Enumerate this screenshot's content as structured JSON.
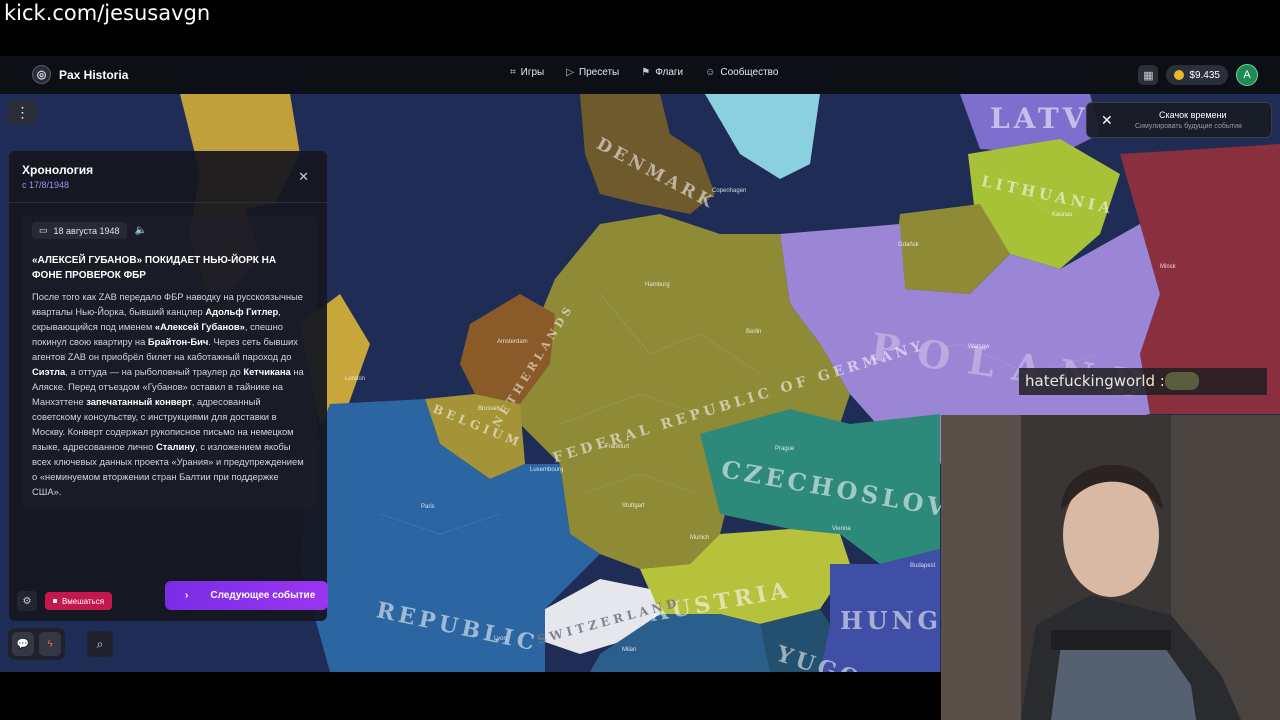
{
  "watermark": {
    "text": "kick.com/jesusavgn"
  },
  "app": {
    "title": "Pax Historia",
    "logo_icon": "globe-icon"
  },
  "nav": {
    "items": [
      {
        "label": "Игры",
        "icon": "gamepad-icon"
      },
      {
        "label": "Пресеты",
        "icon": "play-icon"
      },
      {
        "label": "Флаги",
        "icon": "flag-icon"
      },
      {
        "label": "Сообщество",
        "icon": "users-icon"
      }
    ],
    "balance": "$9.435",
    "avatar_letter": "A"
  },
  "map": {
    "countries": [
      {
        "label": "DENMARK",
        "color": "#6e5a2c"
      },
      {
        "label": "LITHUANIA",
        "color": "#a8c238"
      },
      {
        "label": "LATV",
        "color": "#7e6fcf"
      },
      {
        "label": "POLAND",
        "color": "#9b86d6"
      },
      {
        "label": "FEDERAL REPUBLIC OF GERMANY",
        "color": "#8f8a36"
      },
      {
        "label": "NETHERLANDS",
        "color": "#8a5a28"
      },
      {
        "label": "BELGIUM",
        "color": "#a49437"
      },
      {
        "label": "CZECHOSLOV",
        "color": "#2d8a7b"
      },
      {
        "label": "AUSTRIA",
        "color": "#b6c13c"
      },
      {
        "label": "SWITZERLAND",
        "color": "#e5e7ec"
      },
      {
        "label": "HUNG",
        "color": "#3f4fa6"
      },
      {
        "label": "REPUBLIC",
        "color": "#2c66a2"
      },
      {
        "label": "YUGO",
        "color": "#23506e"
      }
    ],
    "cities": [
      "Copenhagen",
      "Kaunas",
      "Gdańsk",
      "Minsk",
      "Hamburg",
      "Berlin",
      "Warsaw",
      "Amsterdam",
      "Brussels",
      "London",
      "Frankfurt",
      "Prague",
      "Luxembourg",
      "Paris",
      "Stuttgart",
      "Munich",
      "Vienna",
      "Budapest",
      "Milan",
      "Lyon"
    ]
  },
  "timeline": {
    "title": "Хронология",
    "subtitle": "с 17/8/1948",
    "event": {
      "date": "18 августа 1948",
      "headline": "«АЛЕКСЕЙ ГУБАНОВ» ПОКИДАЕТ НЬЮ-ЙОРК НА ФОНЕ ПРОВЕРОК ФБР",
      "body": [
        {
          "text": "После того как ZAB передало ФБР наводку на русскоязычные кварталы Нью-Йорка, бывший канцлер ",
          "bold": false
        },
        {
          "text": "Адольф Гитлер",
          "bold": true
        },
        {
          "text": ", скрывающийся под именем ",
          "bold": false
        },
        {
          "text": "«Алексей Губанов»",
          "bold": true
        },
        {
          "text": ", спешно покинул свою квартиру на ",
          "bold": false
        },
        {
          "text": "Брайтон-Бич",
          "bold": true
        },
        {
          "text": ". Через сеть бывших агентов ZAB он приобрёл билет на каботажный пароход до ",
          "bold": false
        },
        {
          "text": "Сиэтла",
          "bold": true
        },
        {
          "text": ", а оттуда — на рыболовный траулер до ",
          "bold": false
        },
        {
          "text": "Кетчикана",
          "bold": true
        },
        {
          "text": " на Аляске. Перед отъездом «Губанов» оставил в тайнике на Манхэттене ",
          "bold": false
        },
        {
          "text": "запечатанный конверт",
          "bold": true
        },
        {
          "text": ", адресованный советскому консульству, с инструкциями для доставки в Москву. Конверт содержал рукописное письмо на немецком языке, адресованное лично ",
          "bold": false
        },
        {
          "text": "Сталину",
          "bold": true
        },
        {
          "text": ", с изложением якобы всех ключевых данных проекта «Урания» и предупреждением о «неминуемом вторжении стран Балтии при поддержке США».",
          "bold": false
        }
      ]
    },
    "intervene_label": "Вмешаться",
    "next_event_label": "Следующее событие"
  },
  "toast": {
    "title": "Скачок времени",
    "subtitle": "Симулировать будущие события"
  },
  "chat": {
    "text": "hatefuckingworld :"
  }
}
